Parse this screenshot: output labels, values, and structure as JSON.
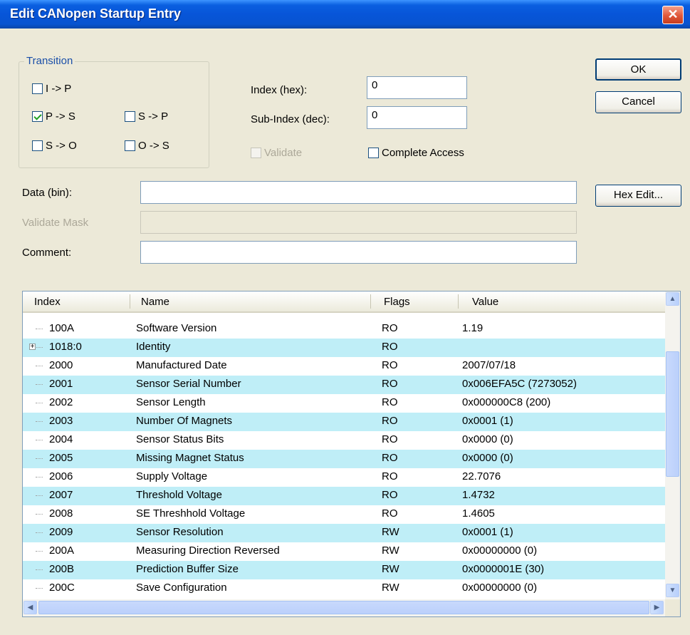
{
  "window": {
    "title": "Edit CANopen Startup Entry",
    "close_glyph": "✕"
  },
  "transition": {
    "legend": "Transition",
    "items": [
      {
        "label": "I -> P",
        "checked": false
      },
      {
        "label": "P -> S",
        "checked": true
      },
      {
        "label": "S -> P",
        "checked": false
      },
      {
        "label": "S -> O",
        "checked": false
      },
      {
        "label": "O -> S",
        "checked": false
      }
    ]
  },
  "index": {
    "label": "Index (hex):",
    "value": "0"
  },
  "subindex": {
    "label": "Sub-Index (dec):",
    "value": "0"
  },
  "validate": {
    "label": "Validate",
    "checked": false,
    "disabled": true
  },
  "complete_access": {
    "label": "Complete Access",
    "checked": false
  },
  "buttons": {
    "ok": "OK",
    "cancel": "Cancel",
    "hex_edit": "Hex Edit..."
  },
  "data_field": {
    "label": "Data (bin):",
    "value": ""
  },
  "validate_mask": {
    "label": "Validate Mask",
    "value": ""
  },
  "comment": {
    "label": "Comment:",
    "value": ""
  },
  "table": {
    "columns": [
      "Index",
      "Name",
      "Flags",
      "Value"
    ],
    "rows": [
      {
        "index": "100A",
        "name": "Software Version",
        "flags": "RO",
        "value": "1.19",
        "expandable": false
      },
      {
        "index": "1018:0",
        "name": "Identity",
        "flags": "RO",
        "value": "",
        "expandable": true
      },
      {
        "index": "2000",
        "name": "Manufactured Date",
        "flags": "RO",
        "value": "2007/07/18",
        "expandable": false
      },
      {
        "index": "2001",
        "name": "Sensor Serial Number",
        "flags": "RO",
        "value": "0x006EFA5C (7273052)",
        "expandable": false
      },
      {
        "index": "2002",
        "name": "Sensor Length",
        "flags": "RO",
        "value": "0x000000C8 (200)",
        "expandable": false
      },
      {
        "index": "2003",
        "name": "Number Of Magnets",
        "flags": "RO",
        "value": "0x0001 (1)",
        "expandable": false
      },
      {
        "index": "2004",
        "name": "Sensor Status Bits",
        "flags": "RO",
        "value": "0x0000 (0)",
        "expandable": false
      },
      {
        "index": "2005",
        "name": "Missing Magnet Status",
        "flags": "RO",
        "value": "0x0000 (0)",
        "expandable": false
      },
      {
        "index": "2006",
        "name": "Supply Voltage",
        "flags": "RO",
        "value": "22.7076",
        "expandable": false
      },
      {
        "index": "2007",
        "name": "Threshold Voltage",
        "flags": "RO",
        "value": "1.4732",
        "expandable": false
      },
      {
        "index": "2008",
        "name": "SE Threshhold Voltage",
        "flags": "RO",
        "value": "1.4605",
        "expandable": false
      },
      {
        "index": "2009",
        "name": "Sensor Resolution",
        "flags": "RW",
        "value": "0x0001 (1)",
        "expandable": false
      },
      {
        "index": "200A",
        "name": "Measuring Direction Reversed",
        "flags": "RW",
        "value": "0x00000000 (0)",
        "expandable": false
      },
      {
        "index": "200B",
        "name": "Prediction Buffer Size",
        "flags": "RW",
        "value": "0x0000001E (30)",
        "expandable": false
      },
      {
        "index": "200C",
        "name": "Save Configuration",
        "flags": "RW",
        "value": "0x00000000 (0)",
        "expandable": false
      }
    ]
  }
}
